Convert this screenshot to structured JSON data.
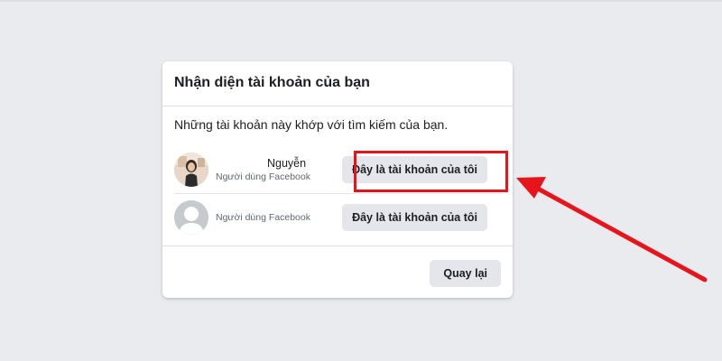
{
  "dialog": {
    "title": "Nhận diện tài khoản của bạn",
    "subtitle": "Những tài khoản này khớp với tìm kiếm của bạn.",
    "accounts": [
      {
        "name": "Nguyễn",
        "type": "Người dùng Facebook",
        "button_label": "Đây là tài khoản của tôi",
        "avatar": "profile-photo"
      },
      {
        "name": "",
        "type": "Người dùng Facebook",
        "button_label": "Đây là tài khoản của tôi",
        "avatar": "default-silhouette-icon"
      }
    ],
    "back_label": "Quay lại"
  },
  "annotation": {
    "color": "#e8141c",
    "shapes": [
      "highlight-box",
      "arrow"
    ]
  },
  "colors": {
    "page_background": "#e9ebee",
    "button_background": "#e4e6eb",
    "text_primary": "#1c1e21",
    "text_secondary": "#606770"
  }
}
